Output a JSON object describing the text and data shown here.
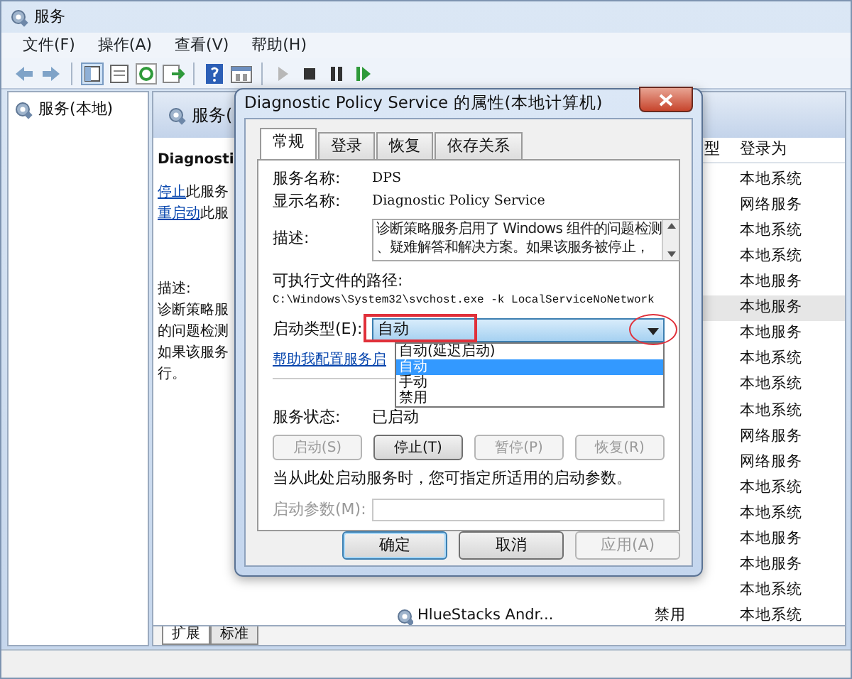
{
  "window": {
    "title": "服务"
  },
  "menu": [
    "文件(F)",
    "操作(A)",
    "查看(V)",
    "帮助(H)"
  ],
  "tree": [
    {
      "label": "服务(本地)"
    }
  ],
  "panel": {
    "header": "服务(",
    "service_title": "Diagnosti",
    "links": [
      {
        "link": "停止",
        "rest": "此服务"
      },
      {
        "link": "重启动",
        "rest": "此服"
      }
    ],
    "description_label": "描述:",
    "description_lines": [
      "诊断策略服",
      "的问题检测",
      "如果该服务",
      "行。"
    ]
  },
  "list": {
    "columns": [
      "型",
      "登录为"
    ],
    "rows": [
      {
        "logon": "本地系统",
        "selected": false
      },
      {
        "logon": "网络服务",
        "selected": false
      },
      {
        "logon": "本地系统",
        "selected": false
      },
      {
        "logon": "本地系统",
        "selected": false
      },
      {
        "logon": "本地服务",
        "selected": false
      },
      {
        "logon": "本地服务",
        "selected": true
      },
      {
        "logon": "本地服务",
        "selected": false
      },
      {
        "logon": "本地系统",
        "selected": false
      },
      {
        "logon": "本地系统",
        "selected": false
      },
      {
        "logon": "本地系统",
        "selected": false
      },
      {
        "logon": "网络服务",
        "selected": false
      },
      {
        "logon": "网络服务",
        "selected": false
      },
      {
        "logon": "本地系统",
        "selected": false
      },
      {
        "logon": "本地系统",
        "selected": false
      },
      {
        "logon": "本地服务",
        "selected": false
      },
      {
        "logon": "本地服务",
        "selected": false
      },
      {
        "logon": "本地系统",
        "selected": false
      },
      {
        "name": "HlueStacks Andr...",
        "startup": "禁用",
        "logon": "本地系统",
        "selected": false
      }
    ]
  },
  "view_tabs": [
    {
      "label": "扩展",
      "selected": true
    },
    {
      "label": "标准",
      "selected": false
    }
  ],
  "dialog": {
    "title": "Diagnostic Policy Service 的属性(本地计算机)",
    "tabs": [
      {
        "label": "常规",
        "selected": true
      },
      {
        "label": "登录",
        "selected": false
      },
      {
        "label": "恢复",
        "selected": false
      },
      {
        "label": "依存关系",
        "selected": false
      }
    ],
    "fields": [
      {
        "label": "服务名称:",
        "value": "DPS"
      },
      {
        "label": "显示名称:",
        "value": "Diagnostic Policy Service"
      }
    ],
    "description": {
      "label": "描述:",
      "lines": [
        "诊断策略服务启用了 Windows 组件的问题检测",
        "、疑难解答和解决方案。如果该服务被停止，"
      ]
    },
    "path_label": "可执行文件的路径:",
    "path": "C:\\Windows\\System32\\svchost.exe -k LocalServiceNoNetwork",
    "startup": {
      "label": "启动类型(E):",
      "value": "自动",
      "expanded": true,
      "options": [
        {
          "label": "自动(延迟启动)",
          "selected": false
        },
        {
          "label": "自动",
          "selected": true
        },
        {
          "label": "手动",
          "selected": false
        },
        {
          "label": "禁用",
          "selected": false
        }
      ]
    },
    "help_link": "帮助我配置服务启",
    "status_label": "服务状态:",
    "status": "已启动",
    "service_buttons": [
      {
        "label": "启动(S)",
        "disabled": true
      },
      {
        "label": "停止(T)",
        "disabled": false
      },
      {
        "label": "暂停(P)",
        "disabled": true
      },
      {
        "label": "恢复(R)",
        "disabled": true
      }
    ],
    "hint": "当从此处启动服务时，您可指定所适用的启动参数。",
    "params": {
      "label": "启动参数(M):",
      "disabled": true
    },
    "buttons": [
      {
        "label": "确定",
        "disabled": false,
        "default": true
      },
      {
        "label": "取消",
        "disabled": false,
        "default": false
      },
      {
        "label": "应用(A)",
        "disabled": true,
        "default": false
      }
    ]
  },
  "annotations": {
    "highlight_box": {
      "color": "#e0303a"
    },
    "highlight_ellipse": {
      "color": "#e0303a"
    }
  }
}
